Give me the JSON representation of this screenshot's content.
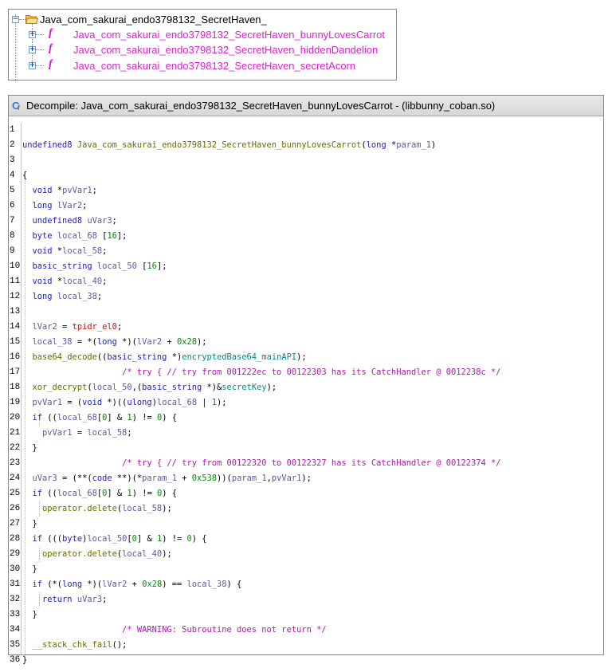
{
  "tree": {
    "root_label": "Java_com_sakurai_endo3798132_SecretHaven_",
    "functions": [
      "Java_com_sakurai_endo3798132_SecretHaven_bunnyLovesCarrot",
      "Java_com_sakurai_endo3798132_SecretHaven_hiddenDandelion",
      "Java_com_sakurai_endo3798132_SecretHaven_secretAcorn"
    ],
    "function_icon_glyph": "f",
    "colors": {
      "function": "#e020d0",
      "folder": "#f0b020"
    }
  },
  "decompile": {
    "title": "Decompile: Java_com_sakurai_endo3798132_SecretHaven_bunnyLovesCarrot -  (libbunny_coban.so)",
    "icon_glyph": "C",
    "icon_sub": "f",
    "line_numbers": [
      "1",
      "2",
      "3",
      "4",
      "5",
      "6",
      "7",
      "8",
      "9",
      "10",
      "11",
      "12",
      "13",
      "14",
      "15",
      "16",
      "17",
      "18",
      "19",
      "20",
      "21",
      "22",
      "23",
      "24",
      "25",
      "26",
      "27",
      "28",
      "29",
      "30",
      "31",
      "32",
      "33",
      "34",
      "35",
      "36"
    ],
    "colors": {
      "keyword": "#1b1bd0",
      "function": "#6b6b00",
      "variable": "#5a5aa0",
      "comment": "#aa1aaa",
      "number": "#0a8a0a"
    }
  }
}
